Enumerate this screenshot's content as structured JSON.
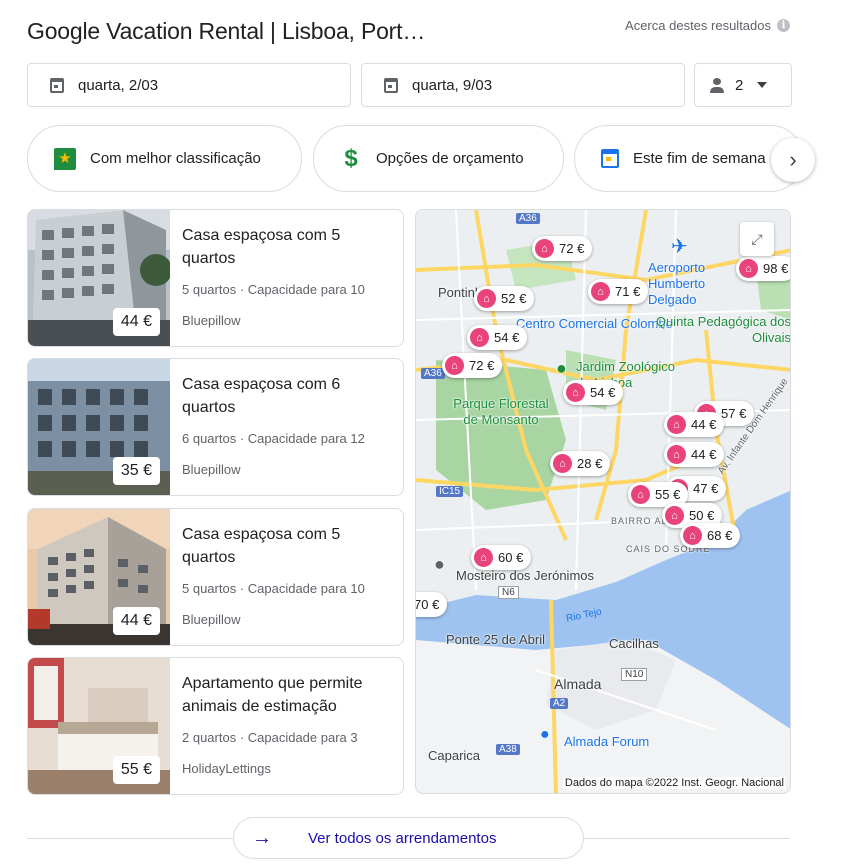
{
  "header": {
    "title": "Google Vacation Rental | Lisboa, Port…",
    "about": "Acerca destes resultados"
  },
  "search": {
    "checkin": "quarta, 2/03",
    "checkout": "quarta, 9/03",
    "guests": "2"
  },
  "chips": [
    {
      "label": "Com melhor classificação",
      "icon": "flag-star-icon"
    },
    {
      "label": "Opções de orçamento",
      "icon": "dollar-icon"
    },
    {
      "label": "Este fim de semana",
      "icon": "calendar-icon"
    }
  ],
  "listings": [
    {
      "name": "Casa espaçosa com 5 quartos",
      "meta": "5 quartos · Capacidade para 10",
      "provider": "Bluepillow",
      "price": "44 €"
    },
    {
      "name": "Casa espaçosa com 6 quartos",
      "meta": "6 quartos · Capacidade para 12",
      "provider": "Bluepillow",
      "price": "35 €"
    },
    {
      "name": "Casa espaçosa com 5 quartos",
      "meta": "5 quartos · Capacidade para 10",
      "provider": "Bluepillow",
      "price": "44 €"
    },
    {
      "name": "Apartamento que permite animais de estimação",
      "meta": "2 quartos · Capacidade para 3",
      "provider": "HolidayLettings",
      "price": "55 €"
    }
  ],
  "map": {
    "pins": [
      "72 €",
      "71 €",
      "52 €",
      "54 €",
      "72 €",
      "54 €",
      "57 €",
      "44 €",
      "44 €",
      "28 €",
      "47 €",
      "55 €",
      "50 €",
      "68 €",
      "60 €",
      "70 €",
      "98 €"
    ],
    "labels": {
      "airport": "Aeroporto Humberto Delgado",
      "colombo": "Centro Comercial Colombo",
      "quinta": "Quinta Pedagógica dos Olivais",
      "zoo": "Jardim Zoológico de Lisboa",
      "monsanto": "Parque Florestal de Monsanto",
      "jeronimos": "Mosteiro dos Jerónimos",
      "ponte": "Ponte 25 de Abril",
      "rio": "Rio Tejo",
      "cacilhas": "Cacilhas",
      "almada": "Almada",
      "almada_forum": "Almada Forum",
      "caparica": "Caparica",
      "pontinha": "Pontinha",
      "bairro": "BAIRRO ALTO",
      "cais": "CAIS DO SODRÉ",
      "infante": "Av. Infante Dom Henrique",
      "road_a36": "A36",
      "road_a2": "A2",
      "road_ic15": "IC15",
      "road_n10": "N10",
      "road_a38": "A38",
      "road_n6": "N6"
    },
    "attribution": "Dados do mapa ©2022 Inst. Geogr. Nacional"
  },
  "footer": {
    "see_all": "Ver todos os arrendamentos"
  }
}
